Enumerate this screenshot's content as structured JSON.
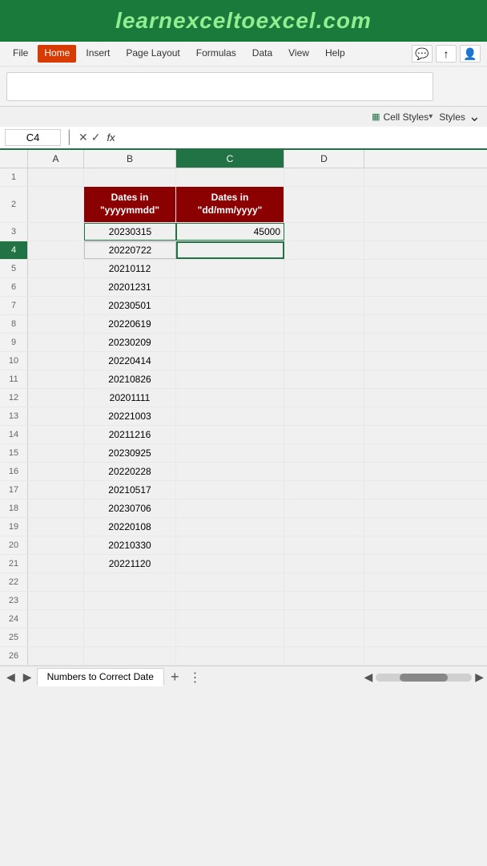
{
  "banner": {
    "text": "learnexceltoexcel.com"
  },
  "menu": {
    "items": [
      "File",
      "Home",
      "Insert",
      "Page Layout",
      "Formulas",
      "Data",
      "View",
      "Help"
    ],
    "active": "Home"
  },
  "formula_bar": {
    "cell_ref": "C4",
    "fx": "fx"
  },
  "col_headers": [
    "A",
    "B",
    "C",
    "D"
  ],
  "rows": [
    {
      "num": 1,
      "b": "",
      "c": ""
    },
    {
      "num": 2,
      "b_header1": "Dates in",
      "b_header2": "\"yyyymmdd\"",
      "c_header1": "Dates in",
      "c_header2": "\"dd/mm/yyyy\""
    },
    {
      "num": 3,
      "b": "20230315",
      "c": "45000"
    },
    {
      "num": 4,
      "b": "20220722",
      "c": ""
    },
    {
      "num": 5,
      "b": "20210112",
      "c": ""
    },
    {
      "num": 6,
      "b": "20201231",
      "c": ""
    },
    {
      "num": 7,
      "b": "20230501",
      "c": ""
    },
    {
      "num": 8,
      "b": "20220619",
      "c": ""
    },
    {
      "num": 9,
      "b": "20230209",
      "c": ""
    },
    {
      "num": 10,
      "b": "20220414",
      "c": ""
    },
    {
      "num": 11,
      "b": "20210826",
      "c": ""
    },
    {
      "num": 12,
      "b": "20201111",
      "c": ""
    },
    {
      "num": 13,
      "b": "20221003",
      "c": ""
    },
    {
      "num": 14,
      "b": "20211216",
      "c": ""
    },
    {
      "num": 15,
      "b": "20230925",
      "c": ""
    },
    {
      "num": 16,
      "b": "20220228",
      "c": ""
    },
    {
      "num": 17,
      "b": "20210517",
      "c": ""
    },
    {
      "num": 18,
      "b": "20230706",
      "c": ""
    },
    {
      "num": 19,
      "b": "20220108",
      "c": ""
    },
    {
      "num": 20,
      "b": "20210330",
      "c": ""
    },
    {
      "num": 21,
      "b": "20221120",
      "c": ""
    },
    {
      "num": 22,
      "b": "",
      "c": ""
    },
    {
      "num": 23,
      "b": "",
      "c": ""
    },
    {
      "num": 24,
      "b": "",
      "c": ""
    },
    {
      "num": 25,
      "b": "",
      "c": ""
    },
    {
      "num": 26,
      "b": "",
      "c": ""
    }
  ],
  "sheet_tab": {
    "name": "Numbers to Correct Date"
  },
  "toolbar": {
    "styles_label": "Cell Styles",
    "styles_section": "Styles"
  },
  "colors": {
    "header_bg": "#8b0000",
    "active_col": "#217346",
    "banner_bg": "#1a7a3c",
    "banner_text": "#90ee90"
  }
}
